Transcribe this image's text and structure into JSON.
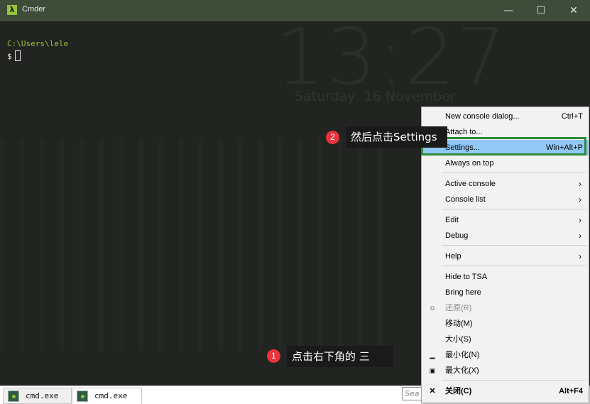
{
  "window": {
    "title": "Cmder",
    "app_icon_glyph": "λ",
    "minimize_glyph": "—",
    "maximize_glyph": "☐",
    "close_glyph": "✕"
  },
  "background": {
    "clock": "13:27",
    "date": "Saturday, 16 November"
  },
  "console": {
    "path": "C:\\Users\\lele",
    "prompt": "$"
  },
  "tabs": [
    {
      "label": "cmd.exe",
      "active": false
    },
    {
      "label": "cmd.exe",
      "active": true
    }
  ],
  "search": {
    "placeholder": "Sea"
  },
  "menu": {
    "items": [
      {
        "label": "New console dialog...",
        "shortcut": "Ctrl+T"
      },
      {
        "label": "Attach to..."
      },
      {
        "label": "Settings...",
        "shortcut": "Win+Alt+P",
        "highlighted": true
      },
      {
        "label": "Always on top"
      },
      {
        "label": "Active console",
        "submenu": "›"
      },
      {
        "label": "Console list",
        "submenu": "›"
      },
      {
        "label": "Edit",
        "submenu": "›"
      },
      {
        "label": "Debug",
        "submenu": "›"
      },
      {
        "label": "Help",
        "submenu": "›"
      },
      {
        "label": "Hide to TSA"
      },
      {
        "label": "Bring here"
      },
      {
        "label": "还原(R)",
        "disabled": true
      },
      {
        "label": "移动(M)"
      },
      {
        "label": "大小(S)"
      },
      {
        "label": "最小化(N)"
      },
      {
        "label": "最大化(X)"
      },
      {
        "label": "关闭(C)",
        "shortcut": "Alt+F4"
      }
    ]
  },
  "annotations": [
    {
      "number": "1",
      "text": "点击右下角的  三"
    },
    {
      "number": "2",
      "text": "然后点击Settings"
    }
  ],
  "colors": {
    "accent_green": "#97c23b",
    "highlight_blue": "#90c8f6",
    "highlight_border": "#2e8b3a",
    "badge_red": "#e8323c"
  }
}
